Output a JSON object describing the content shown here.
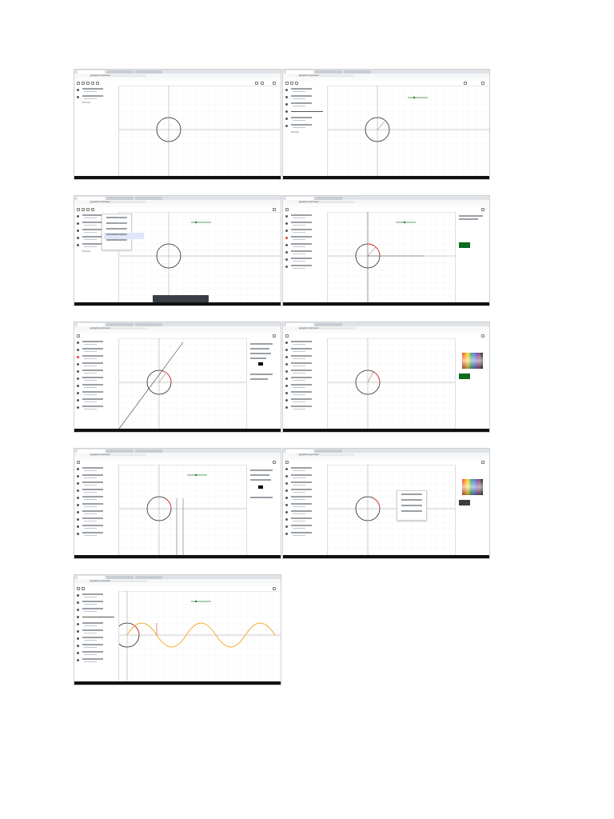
{
  "screenshots": [
    {
      "id": "s1",
      "tabs": [
        "GeoGebra",
        "Google",
        "GeoGebra",
        "Nuevo",
        "Calculadora"
      ],
      "url": "geogebra.org/classic"
    },
    {
      "id": "s2",
      "tabs": [
        "GeoGebra",
        "Google",
        "GeoGebra",
        "Nuevo",
        "Calculadora"
      ],
      "url": "geogebra.org/classic"
    },
    {
      "id": "s3",
      "tabs": [
        "GeoGebra",
        "Google",
        "GeoGebra",
        "Nuevo",
        "Calculadora"
      ],
      "url": "geogebra.org/classic"
    },
    {
      "id": "s4",
      "tabs": [
        "GeoGebra",
        "Google",
        "GeoGebra",
        "Nuevo",
        "Calculadora"
      ],
      "url": "geogebra.org/classic"
    },
    {
      "id": "s5",
      "tabs": [
        "GeoGebra",
        "Google",
        "GeoGebra",
        "Nuevo",
        "Calculadora"
      ],
      "url": "geogebra.org/classic"
    },
    {
      "id": "s6",
      "tabs": [
        "GeoGebra",
        "Google",
        "GeoGebra",
        "Nuevo",
        "Calculadora"
      ],
      "url": "geogebra.org/classic"
    },
    {
      "id": "s7",
      "tabs": [
        "GeoGebra",
        "Google",
        "GeoGebra",
        "Nuevo",
        "Calculadora"
      ],
      "url": "geogebra.org/classic"
    },
    {
      "id": "s8",
      "tabs": [
        "GeoGebra",
        "Google",
        "GeoGebra",
        "Nuevo",
        "Calculadora"
      ],
      "url": "geogebra.org/classic"
    },
    {
      "id": "s9",
      "tabs": [
        "GeoGebra",
        "Google",
        "GeoGebra",
        "Nuevo",
        "Calculadora"
      ],
      "url": "geogebra.org/classic"
    }
  ],
  "algebra_caption": "Entrada",
  "colors": {
    "circle": "#222222",
    "arc": "#e53935",
    "sine": "#f5a623",
    "axis": "#9e9e9e",
    "grid": "#ececec",
    "slider": "#2e7d32",
    "selection": "#0b6b1f"
  },
  "icons": [
    "move-icon",
    "point-icon",
    "line-icon",
    "circle-icon",
    "slider-icon",
    "undo-icon",
    "redo-icon",
    "search-icon",
    "menu-icon"
  ]
}
